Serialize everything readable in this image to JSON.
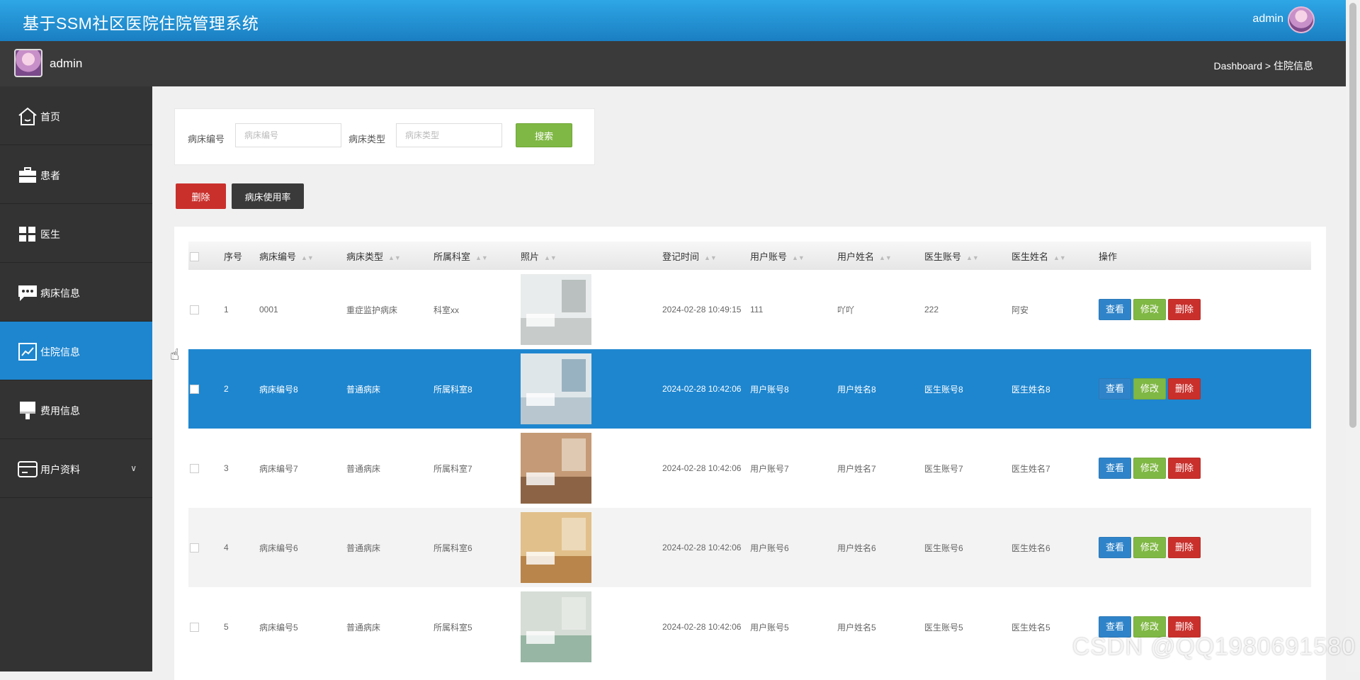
{
  "app": {
    "title": "基于SSM社区医院住院管理系统",
    "user": "admin"
  },
  "subbar": {
    "username": "admin",
    "breadcrumb": "Dashboard > 住院信息"
  },
  "sidebar": {
    "items": [
      {
        "label": "首页",
        "icon": "home-icon"
      },
      {
        "label": "患者",
        "icon": "briefcase-icon"
      },
      {
        "label": "医生",
        "icon": "grid-icon"
      },
      {
        "label": "病床信息",
        "icon": "chat-icon"
      },
      {
        "label": "住院信息",
        "icon": "chart-line-icon",
        "active": true
      },
      {
        "label": "费用信息",
        "icon": "brush-icon"
      },
      {
        "label": "用户资料",
        "icon": "card-icon",
        "expandable": true
      }
    ]
  },
  "search": {
    "field1_label": "病床编号",
    "field1_placeholder": "病床编号",
    "field2_label": "病床类型",
    "field2_placeholder": "病床类型",
    "button": "搜索"
  },
  "actions": {
    "delete": "删除",
    "usage_rate": "病床使用率"
  },
  "table": {
    "headers": [
      "序号",
      "病床编号",
      "病床类型",
      "所属科室",
      "照片",
      "登记时间",
      "用户账号",
      "用户姓名",
      "医生账号",
      "医生姓名",
      "操作"
    ],
    "op_labels": {
      "view": "查看",
      "edit": "修改",
      "delete": "删除"
    },
    "rows": [
      {
        "no": "1",
        "bed_no": "0001",
        "bed_type": "重症监护病床",
        "dept": "科室xx",
        "time": "2024-02-28 10:49:15",
        "user_account": "111",
        "user_name": "吖吖",
        "doctor_account": "222",
        "doctor_name": "阿安"
      },
      {
        "no": "2",
        "bed_no": "病床编号8",
        "bed_type": "普通病床",
        "dept": "所属科室8",
        "time": "2024-02-28 10:42:06",
        "user_account": "用户账号8",
        "user_name": "用户姓名8",
        "doctor_account": "医生账号8",
        "doctor_name": "医生姓名8",
        "selected": true
      },
      {
        "no": "3",
        "bed_no": "病床编号7",
        "bed_type": "普通病床",
        "dept": "所属科室7",
        "time": "2024-02-28 10:42:06",
        "user_account": "用户账号7",
        "user_name": "用户姓名7",
        "doctor_account": "医生账号7",
        "doctor_name": "医生姓名7"
      },
      {
        "no": "4",
        "bed_no": "病床编号6",
        "bed_type": "普通病床",
        "dept": "所属科室6",
        "time": "2024-02-28 10:42:06",
        "user_account": "用户账号6",
        "user_name": "用户姓名6",
        "doctor_account": "医生账号6",
        "doctor_name": "医生姓名6"
      },
      {
        "no": "5",
        "bed_no": "病床编号5",
        "bed_type": "普通病床",
        "dept": "所属科室5",
        "time": "2024-02-28 10:42:06",
        "user_account": "用户账号5",
        "user_name": "用户姓名5",
        "doctor_account": "医生账号5",
        "doctor_name": "医生姓名5"
      }
    ]
  },
  "watermark": "CSDN @QQ1980691580",
  "colors": {
    "primary": "#1e86cf",
    "success": "#80b845",
    "danger": "#c9302c",
    "sidebar": "#333333",
    "topbar": "#2496dc"
  }
}
